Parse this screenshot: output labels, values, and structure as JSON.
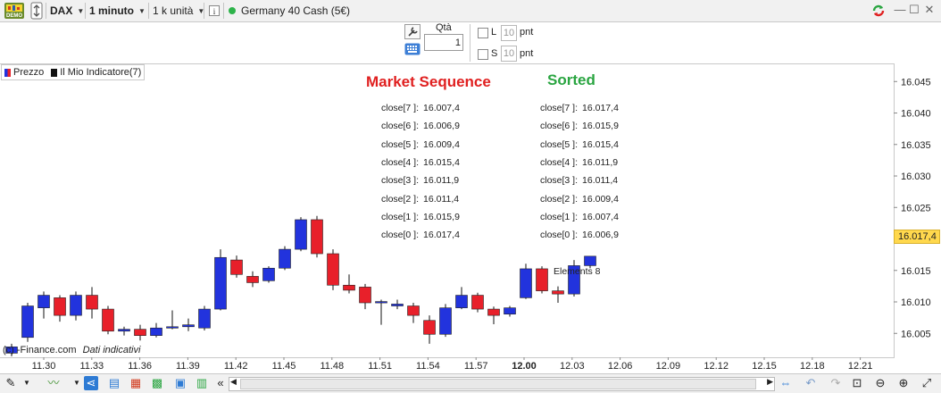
{
  "toolbar": {
    "demo_badge": "DEMO",
    "instrument": "DAX",
    "timeframe": "1 minuto",
    "units": "1 k unità",
    "market": "Germany 40 Cash (5€)"
  },
  "order_panel": {
    "qty_label": "Qtà",
    "qty_value": "1",
    "long_label": "L",
    "long_value": "10",
    "long_unit": "pnt",
    "short_label": "S",
    "short_value": "10",
    "short_unit": "pnt"
  },
  "legend": {
    "price": "Prezzo",
    "indicator": "Il Mio Indicatore(7)"
  },
  "market_sequence": {
    "title": "Market Sequence",
    "rows": [
      {
        "label": "close[7 ]:",
        "value": "16.007,4"
      },
      {
        "label": "close[6 ]:",
        "value": "16.006,9"
      },
      {
        "label": "close[5 ]:",
        "value": "16.009,4"
      },
      {
        "label": "close[4 ]:",
        "value": "16.015,4"
      },
      {
        "label": "close[3 ]:",
        "value": "16.011,9"
      },
      {
        "label": "close[2 ]:",
        "value": "16.011,4"
      },
      {
        "label": "close[1 ]:",
        "value": "16.015,9"
      },
      {
        "label": "close[0 ]:",
        "value": "16.017,4"
      }
    ]
  },
  "sorted": {
    "title": "Sorted",
    "rows": [
      {
        "label": "close[7 ]:",
        "value": "16.017,4"
      },
      {
        "label": "close[6 ]:",
        "value": "16.015,9"
      },
      {
        "label": "close[5 ]:",
        "value": "16.015,4"
      },
      {
        "label": "close[4 ]:",
        "value": "16.011,9"
      },
      {
        "label": "close[3 ]:",
        "value": "16.011,4"
      },
      {
        "label": "close[2 ]:",
        "value": "16.009,4"
      },
      {
        "label": "close[1 ]:",
        "value": "16.007,4"
      },
      {
        "label": "close[0 ]:",
        "value": "16.006,9"
      }
    ]
  },
  "elements_label": "Elements 8",
  "watermark": "(c) -Finance.com",
  "watermark_note": "Dati indicativi",
  "current_price_tag": "16.017,4",
  "colors": {
    "up": "#2233dd",
    "down": "#e8202a",
    "price_tag": "#ffd84d",
    "ms_title": "#e02020",
    "sorted_title": "#2aa541"
  },
  "chart_data": {
    "type": "candlestick",
    "y_ticks": [
      "16.045",
      "16.040",
      "16.035",
      "16.030",
      "16.025",
      "16.020",
      "16.015",
      "16.010",
      "16.005"
    ],
    "y_tick_values": [
      16045,
      16040,
      16035,
      16030,
      16025,
      16020,
      16015,
      16010,
      16005
    ],
    "ylim": [
      16002.2,
      16046.6
    ],
    "x_ticks": [
      "11.30",
      "11.33",
      "11.36",
      "11.39",
      "11.42",
      "11.45",
      "11.48",
      "11.51",
      "11.54",
      "11.57",
      "12.00",
      "12.03",
      "12.06",
      "12.09",
      "12.12",
      "12.15",
      "12.18",
      "12.21"
    ],
    "x_tick_bold": "12.00",
    "candles": [
      {
        "t": "11.29",
        "o": 16002.0,
        "h": 16003.5,
        "l": 16001.5,
        "c": 16003.0
      },
      {
        "t": "11.30",
        "o": 16004.5,
        "h": 16010.0,
        "l": 16003.8,
        "c": 16009.5
      },
      {
        "t": "11.31",
        "o": 16009.2,
        "h": 16011.8,
        "l": 16007.5,
        "c": 16011.2
      },
      {
        "t": "11.32",
        "o": 16010.8,
        "h": 16011.2,
        "l": 16007.0,
        "c": 16008.0
      },
      {
        "t": "11.33",
        "o": 16008.0,
        "h": 16011.8,
        "l": 16007.2,
        "c": 16011.2
      },
      {
        "t": "11.34",
        "o": 16011.2,
        "h": 16012.5,
        "l": 16007.5,
        "c": 16009.0
      },
      {
        "t": "11.35",
        "o": 16009.0,
        "h": 16009.5,
        "l": 16005.0,
        "c": 16005.5
      },
      {
        "t": "11.36",
        "o": 16005.5,
        "h": 16006.2,
        "l": 16004.8,
        "c": 16005.8
      },
      {
        "t": "11.37",
        "o": 16005.8,
        "h": 16006.5,
        "l": 16004.0,
        "c": 16004.8
      },
      {
        "t": "11.38",
        "o": 16004.8,
        "h": 16006.8,
        "l": 16004.5,
        "c": 16006.0
      },
      {
        "t": "11.39",
        "o": 16006.0,
        "h": 16008.8,
        "l": 16005.8,
        "c": 16006.2
      },
      {
        "t": "11.40",
        "o": 16006.2,
        "h": 16007.5,
        "l": 16005.5,
        "c": 16006.5
      },
      {
        "t": "11.41",
        "o": 16006.0,
        "h": 16009.5,
        "l": 16005.6,
        "c": 16009.0
      },
      {
        "t": "11.42",
        "o": 16009.0,
        "h": 16018.5,
        "l": 16008.8,
        "c": 16017.2
      },
      {
        "t": "11.43",
        "o": 16016.8,
        "h": 16017.5,
        "l": 16014.0,
        "c": 16014.5
      },
      {
        "t": "11.44",
        "o": 16014.2,
        "h": 16015.0,
        "l": 16012.5,
        "c": 16013.2
      },
      {
        "t": "11.45",
        "o": 16013.5,
        "h": 16015.8,
        "l": 16013.2,
        "c": 16015.5
      },
      {
        "t": "11.46",
        "o": 16015.5,
        "h": 16019.0,
        "l": 16015.2,
        "c": 16018.5
      },
      {
        "t": "11.47",
        "o": 16018.5,
        "h": 16023.6,
        "l": 16018.2,
        "c": 16023.2
      },
      {
        "t": "11.48",
        "o": 16023.2,
        "h": 16023.8,
        "l": 16017.2,
        "c": 16017.8
      },
      {
        "t": "11.49",
        "o": 16017.8,
        "h": 16018.5,
        "l": 16012.0,
        "c": 16012.8
      },
      {
        "t": "11.50",
        "o": 16012.8,
        "h": 16014.5,
        "l": 16011.5,
        "c": 16012.0
      },
      {
        "t": "11.51",
        "o": 16012.5,
        "h": 16013.0,
        "l": 16009.0,
        "c": 16010.0
      },
      {
        "t": "11.52",
        "o": 16010.0,
        "h": 16010.5,
        "l": 16006.5,
        "c": 16010.2
      },
      {
        "t": "11.53",
        "o": 16009.5,
        "h": 16010.5,
        "l": 16009.0,
        "c": 16009.8
      },
      {
        "t": "11.54",
        "o": 16009.5,
        "h": 16010.0,
        "l": 16006.8,
        "c": 16008.0
      },
      {
        "t": "11.55",
        "o": 16007.2,
        "h": 16008.0,
        "l": 16003.5,
        "c": 16005.0
      },
      {
        "t": "11.56",
        "o": 16005.0,
        "h": 16009.8,
        "l": 16004.6,
        "c": 16009.2
      },
      {
        "t": "11.57",
        "o": 16009.2,
        "h": 16012.5,
        "l": 16009.0,
        "c": 16011.2
      },
      {
        "t": "11.58",
        "o": 16011.2,
        "h": 16011.6,
        "l": 16008.5,
        "c": 16009.0
      },
      {
        "t": "11.59",
        "o": 16009.0,
        "h": 16009.4,
        "l": 16006.6,
        "c": 16008.0
      },
      {
        "t": "12.00",
        "o": 16008.2,
        "h": 16009.5,
        "l": 16007.8,
        "c": 16009.2
      },
      {
        "t": "12.01",
        "o": 16010.8,
        "h": 16016.2,
        "l": 16010.6,
        "c": 16015.4
      },
      {
        "t": "12.02",
        "o": 16015.4,
        "h": 16015.8,
        "l": 16011.5,
        "c": 16011.9
      },
      {
        "t": "12.03",
        "o": 16011.9,
        "h": 16012.6,
        "l": 16010.0,
        "c": 16011.4
      },
      {
        "t": "12.04",
        "o": 16011.4,
        "h": 16016.8,
        "l": 16011.0,
        "c": 16015.9
      },
      {
        "t": "12.05",
        "o": 16015.9,
        "h": 16017.4,
        "l": 16015.5,
        "c": 16017.4
      }
    ]
  }
}
